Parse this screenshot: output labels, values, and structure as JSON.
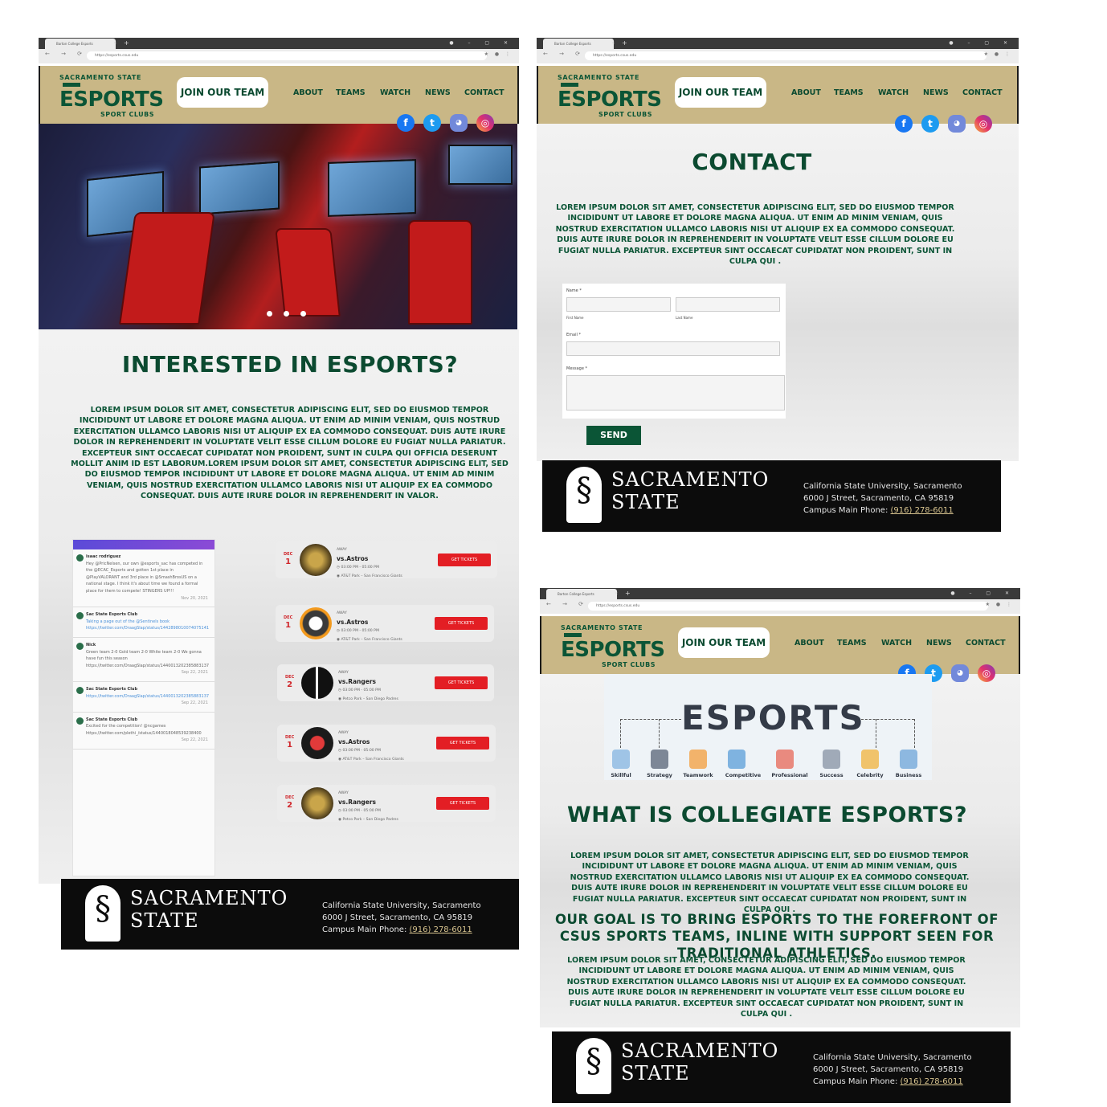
{
  "browser": {
    "tab_title": "Barton College Esports",
    "url": "https://esports.csus.edu"
  },
  "header": {
    "logo_top": "SACRAMENTO STATE",
    "logo_main": "ESPORTS",
    "logo_bottom": "SPORT CLUBS",
    "join_label": "JOIN OUR TEAM",
    "menu": [
      "ABOUT",
      "TEAMS",
      "WATCH",
      "NEWS",
      "CONTACT"
    ]
  },
  "social_icons": [
    "facebook-icon",
    "twitter-icon",
    "discord-icon",
    "instagram-icon"
  ],
  "home": {
    "heading": "INTERESTED IN ESPORTS?",
    "body": "Lorem ipsum dolor sit amet, consectetur adipiscing elit, sed do eiusmod tempor incididunt ut labore et dolore magna aliqua. Ut enim ad minim veniam, quis nostrud exercitation ullamco laboris nisi ut aliquip ex ea commodo consequat. Duis aute irure dolor in reprehenderit in voluptate velit esse cillum dolore eu fugiat nulla pariatur. Excepteur sint occaecat cupidatat non proident, sunt in culpa qui officia deserunt mollit anim id est laborum.Lorem ipsum dolor sit amet, consectetur adipiscing elit, sed do eiusmod tempor incididunt ut labore et dolore magna aliqua. Ut enim ad minim veniam, quis nostrud exercitation ullamco laboris nisi ut aliquip ex ea commodo consequat. Duis aute irure dolor in reprehenderit in valor.",
    "feed": [
      {
        "user": "isaac rodriguez",
        "text": "Hey @PricNelsen, our own @esports_sac has competed in the @ECAC_Esports and gotten 1st place in @PlayVALORANT and 3rd place in @SmashBrosUS on a national stage. I think it's about time we found a formal place for them to compete! STINGERS UP!!!",
        "date": "Nov 20, 2021"
      },
      {
        "user": "Sac State Esports Club",
        "text": "Taking a page out of the @Sentinels book https://twitter.com/DraagSlap/status/1442898010074075141",
        "date": ""
      },
      {
        "user": "Nick",
        "text": "Green team 2-0 Gold team 2-0 White team 2-0 We gonna have fun this season https://twitter.com/DraagSlap/status/1440013202385883137",
        "date": "Sep 22, 2021"
      },
      {
        "user": "Sac State Esports Club",
        "text": "https://twitter.com/DraagSlap/status/1440013202385883137",
        "date": "Sep 22, 2021"
      },
      {
        "user": "Sac State Esports Club",
        "text": "Excited for the competition! @ncgames https://twitter.com/plethi_/status/1440018048539238400",
        "date": "Sep 22, 2021"
      }
    ],
    "events": [
      {
        "month": "DEC",
        "day": "1",
        "game_icon": "league-of-legends-icon",
        "tag": "AWAY",
        "opponent": "vs.Astros",
        "time": "03:00 PM - 05:00 PM",
        "venue": "AT&T Park – San Francisco Giants",
        "button": "GET TICKETS"
      },
      {
        "month": "DEC",
        "day": "1",
        "game_icon": "overwatch-icon",
        "tag": "AWAY",
        "opponent": "vs.Astros",
        "time": "03:00 PM - 05:00 PM",
        "venue": "AT&T Park – San Francisco Giants",
        "button": "GET TICKETS"
      },
      {
        "month": "DEC",
        "day": "2",
        "game_icon": "smash-bros-icon",
        "tag": "AWAY",
        "opponent": "vs.Rangers",
        "time": "03:00 PM - 05:00 PM",
        "venue": "Petco Park – San Diego Padres",
        "button": "GET TICKETS"
      },
      {
        "month": "DEC",
        "day": "1",
        "game_icon": "valorant-icon",
        "tag": "AWAY",
        "opponent": "vs.Astros",
        "time": "03:00 PM - 05:00 PM",
        "venue": "AT&T Park – San Francisco Giants",
        "button": "GET TICKETS"
      },
      {
        "month": "DEC",
        "day": "2",
        "game_icon": "league-of-legends-icon",
        "tag": "AWAY",
        "opponent": "vs.Rangers",
        "time": "03:00 PM - 05:00 PM",
        "venue": "Petco Park – San Diego Padres",
        "button": "GET TICKETS"
      }
    ]
  },
  "contact": {
    "heading": "CONTACT",
    "body": "Lorem ipsum dolor sit amet, consectetur adipiscing elit, sed do eiusmod tempor incididunt ut labore et dolore magna aliqua. Ut enim ad minim veniam, quis nostrud exercitation ullamco laboris nisi ut aliquip ex ea commodo consequat. Duis aute irure dolor in reprehenderit in voluptate velit esse cillum dolore eu fugiat nulla pariatur. Excepteur sint occaecat cupidatat non proident, sunt in culpa qui .",
    "name_label": "Name *",
    "first_label": "First Name",
    "last_label": "Last Name",
    "email_label": "Email *",
    "message_label": "Message *",
    "send_label": "SEND"
  },
  "about": {
    "graphic_title": "ESPORTS",
    "graphic_labels": [
      "Skillful",
      "Strategy",
      "Teamwork",
      "Competitive",
      "Professional",
      "Success",
      "Celebrity",
      "Business"
    ],
    "heading": "WHAT IS COLLEGIATE ESPORTS?",
    "body1": "Lorem ipsum dolor sit amet, consectetur adipiscing elit, sed do eiusmod tempor incididunt ut labore et dolore magna aliqua. Ut enim ad minim veniam, quis nostrud exercitation ullamco laboris nisi ut aliquip ex ea commodo consequat. Duis aute irure dolor in reprehenderit in voluptate velit esse cillum dolore eu fugiat nulla pariatur. Excepteur sint occaecat cupidatat non proident, sunt in culpa qui .",
    "goal": "OUR GOAL IS TO BRING ESPORTS TO THE FOREFRONT OF CSUS SPORTS TEAMS, INLINE WITH SUPPORT SEEN FOR TRADITIONAL ATHLETICS.",
    "body2": "Lorem ipsum dolor sit amet, consectetur adipiscing elit, sed do eiusmod tempor incididunt ut labore et dolore magna aliqua. Ut enim ad minim veniam, quis nostrud exercitation ullamco laboris nisi ut aliquip ex ea commodo consequat. Duis aute irure dolor in reprehenderit in voluptate velit esse cillum dolore eu fugiat nulla pariatur. Excepteur sint occaecat cupidatat non proident, sunt in culpa qui ."
  },
  "footer": {
    "name_line1": "SACRAMENTO",
    "name_line2": "STATE",
    "addr1": "California State University, Sacramento",
    "addr2": "6000 J Street, Sacramento, CA  95819",
    "phone_label": "Campus Main Phone: ",
    "phone": "(916) 278-6011"
  },
  "colors": {
    "brand_green": "#0b5536",
    "header_gold": "#c9b786",
    "ticket_red": "#e31e24",
    "footer_black": "#0c0c0c"
  }
}
